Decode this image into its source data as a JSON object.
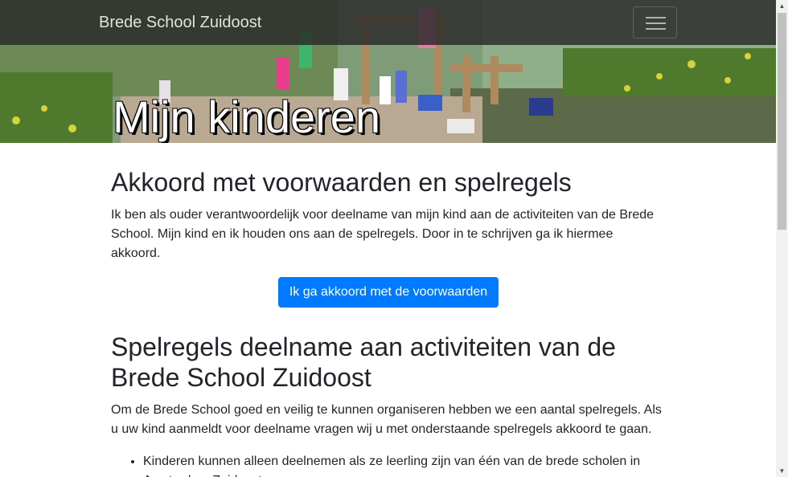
{
  "navbar": {
    "brand": "Brede School Zuidoost",
    "toggle_icon": "hamburger-menu-icon"
  },
  "hero": {
    "title": "Mijn kinderen"
  },
  "section_terms": {
    "title": "Akkoord met voorwaarden en spelregels",
    "text": "Ik ben als ouder verantwoordelijk voor deelname van mijn kind aan de activiteiten van de Brede School. Mijn kind en ik houden ons aan de spelregels. Door in te schrijven ga ik hiermee akkoord.",
    "button_label": "Ik ga akkoord met de voorwaarden"
  },
  "section_rules": {
    "title": "Spelregels deelname aan activiteiten van de Brede School Zuidoost",
    "intro": "Om de Brede School goed en veilig te kunnen organiseren hebben we een aantal spelregels. Als u uw kind aanmeldt voor deelname vragen wij u met onderstaande spelregels akkoord te gaan.",
    "items": [
      "Kinderen kunnen alleen deelnemen als ze leerling zijn van één van de brede scholen in Amsterdam Zuidoost."
    ]
  },
  "colors": {
    "primary": "#007bff",
    "navbar_bg": "#282828",
    "text": "#212529"
  }
}
